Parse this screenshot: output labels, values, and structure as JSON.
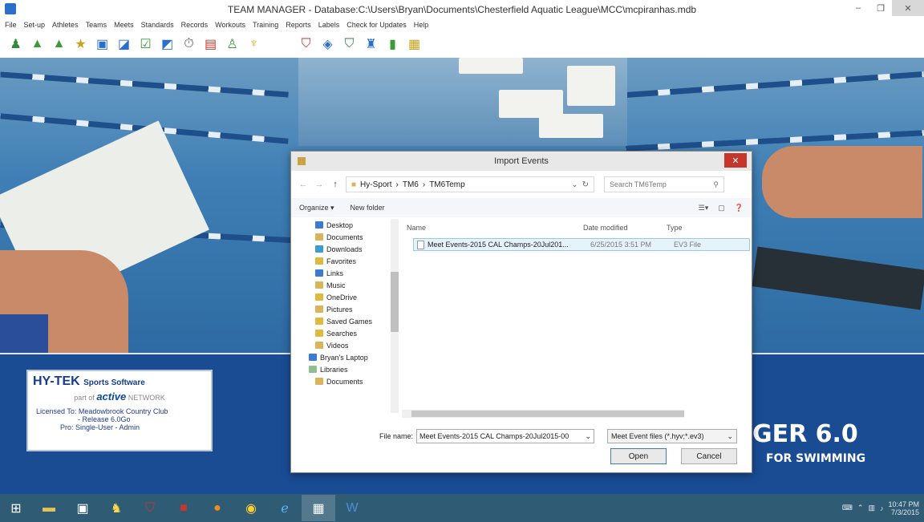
{
  "window": {
    "title": "TEAM MANAGER - Database:C:\\Users\\Bryan\\Documents\\Chesterfield Aquatic League\\MCC\\mcpiranhas.mdb"
  },
  "menu": [
    "File",
    "Set-up",
    "Athletes",
    "Teams",
    "Meets",
    "Standards",
    "Records",
    "Workouts",
    "Training",
    "Reports",
    "Labels",
    "Check for Updates",
    "Help"
  ],
  "toolbar_icons": [
    "athlete-icon",
    "team-add-icon",
    "team-icon",
    "star-icon",
    "meet-icon",
    "import-icon",
    "check-icon",
    "export-icon",
    "stopwatch-icon",
    "report-icon",
    "relay-icon",
    "trophy-icon",
    "shield-icon",
    "map-icon",
    "shield2-icon",
    "group-icon",
    "tool-icon",
    "help-icon"
  ],
  "license": {
    "brand": "HY-TEK",
    "brand_sub": "Sports Software",
    "part_of": "part of",
    "active": "active",
    "network": "NETWORK",
    "line1": "Licensed To:  Meadowbrook Country Club",
    "line2": "- Release 6.0Go",
    "line3": "Pro:  Single-User - Admin"
  },
  "splash": {
    "title": "GER 6.0",
    "subtitle": "FOR SWIMMING"
  },
  "dialog": {
    "title": "Import Events",
    "path": [
      "Hy-Sport",
      "TM6",
      "TM6Temp"
    ],
    "search_placeholder": "Search TM6Temp",
    "organize": "Organize ▾",
    "new_folder": "New folder",
    "nav": [
      {
        "label": "Desktop",
        "color": "#3a7bd5"
      },
      {
        "label": "Documents",
        "color": "#d8b45a"
      },
      {
        "label": "Downloads",
        "color": "#3a9bd5"
      },
      {
        "label": "Favorites",
        "color": "#e0b93f"
      },
      {
        "label": "Links",
        "color": "#3a7bd5"
      },
      {
        "label": "Music",
        "color": "#d8b45a"
      },
      {
        "label": "OneDrive",
        "color": "#e0b93f"
      },
      {
        "label": "Pictures",
        "color": "#d8b45a"
      },
      {
        "label": "Saved Games",
        "color": "#e0b93f"
      },
      {
        "label": "Searches",
        "color": "#e0b93f"
      },
      {
        "label": "Videos",
        "color": "#d8b45a"
      },
      {
        "label": "Bryan's Laptop",
        "color": "#3a7bd5"
      },
      {
        "label": "Libraries",
        "color": "#8fbf8f"
      },
      {
        "label": "Documents",
        "color": "#d8b45a"
      }
    ],
    "columns": {
      "name": "Name",
      "date": "Date modified",
      "type": "Type"
    },
    "file": {
      "name": "Meet Events-2015 CAL Champs-20Jul201...",
      "date": "6/25/2015 3:51 PM",
      "type": "EV3 File"
    },
    "filename_label": "File name:",
    "filename_value": "Meet Events-2015 CAL Champs-20Jul2015-00",
    "filetype": "Meet Event files (*.hyv;*.ev3)",
    "open": "Open",
    "cancel": "Cancel"
  },
  "taskbar": {
    "time": "10:47 PM",
    "date": "7/3/2015"
  }
}
